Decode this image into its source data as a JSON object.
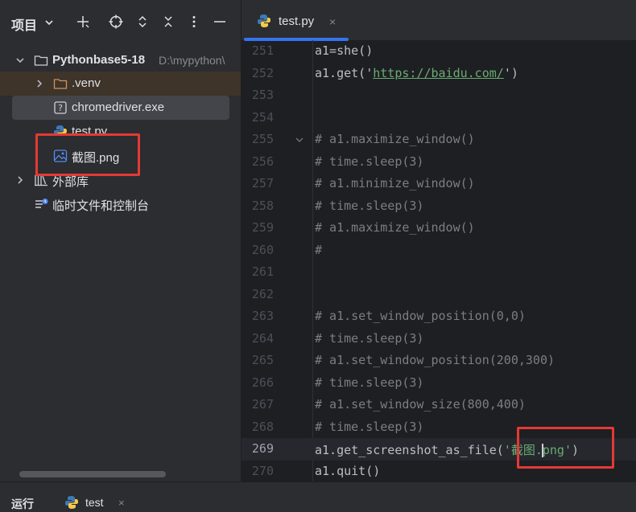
{
  "project_panel": {
    "title": "项目",
    "tree": [
      {
        "label": "Pythonbase5-18",
        "path": "D:\\mypython\\",
        "type": "project-root"
      },
      {
        "label": ".venv",
        "type": "folder"
      },
      {
        "label": "chromedriver.exe",
        "type": "unknown-file"
      },
      {
        "label": "test.py",
        "type": "python-file"
      },
      {
        "label": "截图.png",
        "type": "image-file"
      },
      {
        "label": "外部库",
        "type": "library"
      },
      {
        "label": "临时文件和控制台",
        "type": "scratches"
      }
    ]
  },
  "editor": {
    "tab_label": "test.py",
    "tab_close": "×",
    "current_line": "269",
    "lines": [
      {
        "n": "251",
        "parts": [
          {
            "t": "a1=she()",
            "c": "code"
          }
        ]
      },
      {
        "n": "252",
        "parts": [
          {
            "t": "a1.get('",
            "c": "code"
          },
          {
            "t": "https://baidu.com/",
            "c": "url"
          },
          {
            "t": "')",
            "c": "code"
          }
        ]
      },
      {
        "n": "253",
        "parts": []
      },
      {
        "n": "254",
        "parts": []
      },
      {
        "n": "255",
        "parts": [
          {
            "t": "# a1.maximize_window()",
            "c": "comment"
          }
        ],
        "fold": true
      },
      {
        "n": "256",
        "parts": [
          {
            "t": "# time.sleep(3)",
            "c": "comment"
          }
        ]
      },
      {
        "n": "257",
        "parts": [
          {
            "t": "# a1.minimize_window()",
            "c": "comment"
          }
        ]
      },
      {
        "n": "258",
        "parts": [
          {
            "t": "# time.sleep(3)",
            "c": "comment"
          }
        ]
      },
      {
        "n": "259",
        "parts": [
          {
            "t": "# a1.maximize_window()",
            "c": "comment"
          }
        ]
      },
      {
        "n": "260",
        "parts": [
          {
            "t": "#",
            "c": "comment"
          }
        ]
      },
      {
        "n": "261",
        "parts": []
      },
      {
        "n": "262",
        "parts": []
      },
      {
        "n": "263",
        "parts": [
          {
            "t": "# a1.set_window_position(0,0)",
            "c": "comment"
          }
        ]
      },
      {
        "n": "264",
        "parts": [
          {
            "t": "# time.sleep(3)",
            "c": "comment"
          }
        ]
      },
      {
        "n": "265",
        "parts": [
          {
            "t": "# a1.set_window_position(200,300)",
            "c": "comment"
          }
        ]
      },
      {
        "n": "266",
        "parts": [
          {
            "t": "# time.sleep(3)",
            "c": "comment"
          }
        ]
      },
      {
        "n": "267",
        "parts": [
          {
            "t": "# a1.set_window_size(800,400)",
            "c": "comment"
          }
        ]
      },
      {
        "n": "268",
        "parts": [
          {
            "t": "# time.sleep(3)",
            "c": "comment"
          }
        ]
      },
      {
        "n": "269",
        "parts": [
          {
            "t": "a1.get_screenshot_as_file(",
            "c": "code"
          },
          {
            "t": "'截图.",
            "c": "str"
          },
          {
            "t": "",
            "c": "caret"
          },
          {
            "t": "png'",
            "c": "str"
          },
          {
            "t": ")",
            "c": "code"
          }
        ]
      },
      {
        "n": "270",
        "parts": [
          {
            "t": "a1.quit()",
            "c": "code"
          }
        ]
      }
    ]
  },
  "bottom_bar": {
    "run_label": "运行",
    "tab_label": "test",
    "tab_close": "×"
  },
  "colors": {
    "panel_bg": "#2b2d30",
    "editor_bg": "#1e1f22",
    "accent": "#3574f0",
    "highlight_box": "#e53935",
    "string": "#6aab73",
    "comment": "#7a7e85"
  }
}
